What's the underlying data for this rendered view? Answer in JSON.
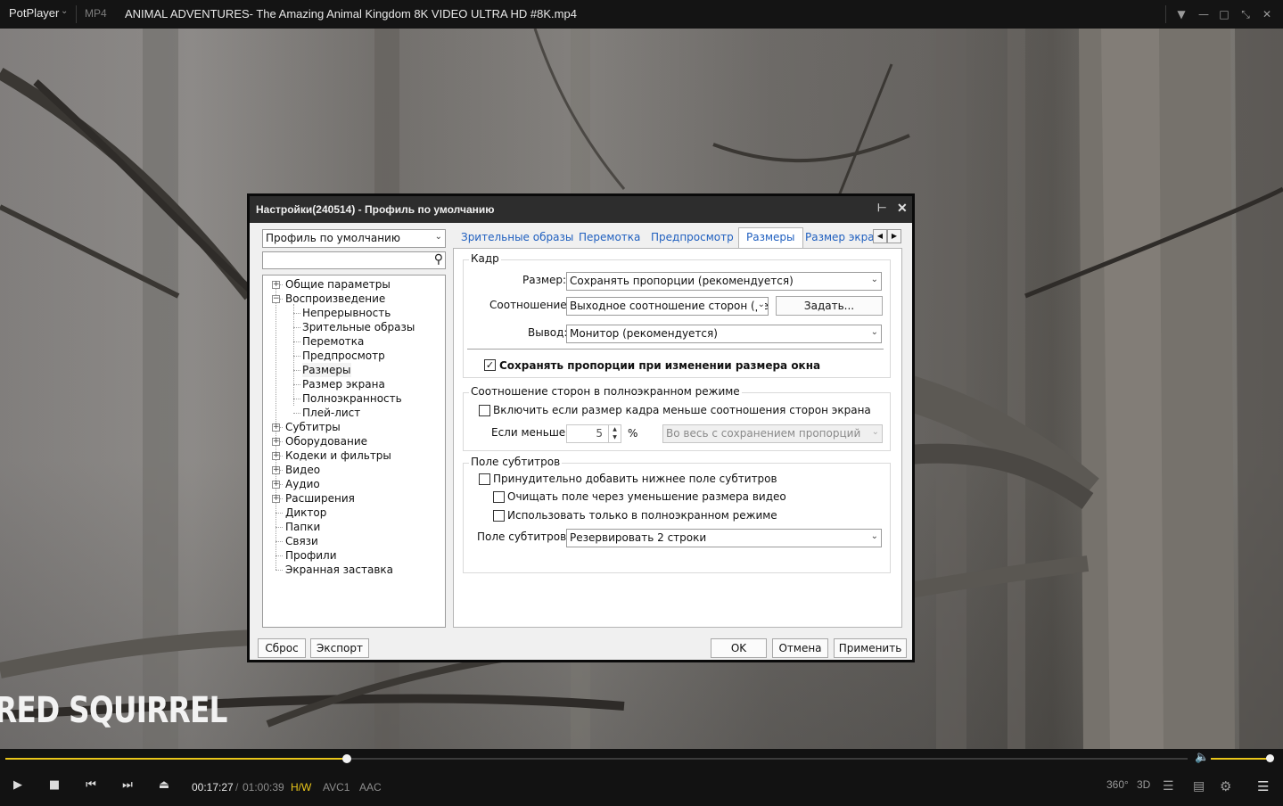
{
  "app": {
    "name": "PotPlayer",
    "format": "MP4",
    "file_title": "ANIMAL ADVENTURES- The Amazing Animal Kingdom 8K VIDEO ULTRA HD #8K.mp4"
  },
  "video": {
    "caption": "RED SQUIRREL"
  },
  "controls": {
    "current_time": "00:17:27",
    "separator": "/",
    "total_time": "01:00:39",
    "hw": "H/W",
    "vcodec": "AVC1",
    "acodec": "AAC",
    "seek_progress": 0.289,
    "volume_level": 0.97,
    "accent_color": "#e8c51a",
    "right_buttons": [
      "360°",
      "3D"
    ]
  },
  "dialog": {
    "title": "Настройки(240514) - Профиль по умолчанию",
    "profile_select": "Профиль по умолчанию",
    "search_placeholder": "",
    "tree": [
      {
        "label": "Общие параметры",
        "level": 0,
        "expander": "+"
      },
      {
        "label": "Воспроизведение",
        "level": 0,
        "expander": "-"
      },
      {
        "label": "Непрерывность",
        "level": 1
      },
      {
        "label": "Зрительные образы",
        "level": 1
      },
      {
        "label": "Перемотка",
        "level": 1
      },
      {
        "label": "Предпросмотр",
        "level": 1
      },
      {
        "label": "Размеры",
        "level": 1,
        "selected": true
      },
      {
        "label": "Размер экрана",
        "level": 1
      },
      {
        "label": "Полноэкранность",
        "level": 1
      },
      {
        "label": "Плей-лист",
        "level": 1
      },
      {
        "label": "Субтитры",
        "level": 0,
        "expander": "+"
      },
      {
        "label": "Оборудование",
        "level": 0,
        "expander": "+"
      },
      {
        "label": "Кодеки и фильтры",
        "level": 0,
        "expander": "+"
      },
      {
        "label": "Видео",
        "level": 0,
        "expander": "+"
      },
      {
        "label": "Аудио",
        "level": 0,
        "expander": "+"
      },
      {
        "label": "Расширения",
        "level": 0,
        "expander": "+"
      },
      {
        "label": "Диктор",
        "level": 0
      },
      {
        "label": "Папки",
        "level": 0
      },
      {
        "label": "Связи",
        "level": 0
      },
      {
        "label": "Профили",
        "level": 0
      },
      {
        "label": "Экранная заставка",
        "level": 0
      }
    ],
    "tabs": [
      {
        "label": "Зрительные образы"
      },
      {
        "label": "Перемотка"
      },
      {
        "label": "Предпросмотр"
      },
      {
        "label": "Размеры",
        "active": true
      },
      {
        "label": "Размер экра"
      }
    ],
    "frame": {
      "group_label": "Кадр",
      "size_label": "Размер:",
      "size_value": "Сохранять пропорции (рекомендуется)",
      "ratio_label": "Соотношение:",
      "ratio_value": "Выходное соотношение сторон (ре",
      "set_button": "Задать...",
      "output_label": "Вывод:",
      "output_value": "Монитор (рекомендуется)",
      "keep_aspect_checkbox": "Сохранять пропорции при изменении размера окна",
      "keep_aspect_checked": true
    },
    "fullscreen": {
      "group_label": "Соотношение сторон в полноэкранном режиме",
      "enable_checkbox": "Включить если размер кадра меньше соотношения сторон экрана",
      "enable_checked": false,
      "if_less_label": "Если меньше:",
      "if_less_value": "5",
      "percent": "%",
      "mode_value": "Во весь с сохранением пропорций"
    },
    "subtitle_field": {
      "group_label": "Поле субтитров",
      "force_checkbox": "Принудительно добавить нижнее поле субтитров",
      "force_checked": false,
      "clear_checkbox": "Очищать поле через уменьшение размера видео",
      "clear_checked": false,
      "fullscreen_only_checkbox": "Использовать только в полноэкранном режиме",
      "fullscreen_only_checked": false,
      "field_label": "Поле субтитров:",
      "field_value": "Резервировать 2 строки"
    },
    "buttons": {
      "reset": "Сброс",
      "export": "Экспорт",
      "ok": "OK",
      "cancel": "Отмена",
      "apply": "Применить"
    }
  }
}
